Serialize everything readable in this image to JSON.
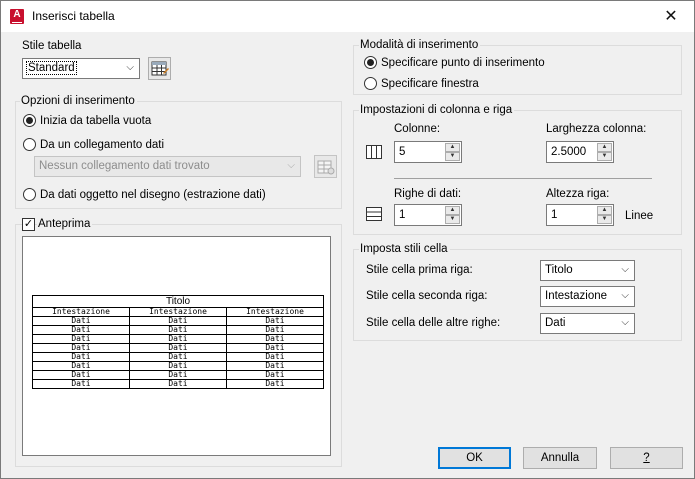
{
  "window": {
    "title": "Inserisci tabella",
    "close_glyph": "✕",
    "app_icon_letter": "A"
  },
  "table_style": {
    "label": "Stile tabella",
    "value": "Standard"
  },
  "insert_options": {
    "label": "Opzioni di inserimento",
    "empty_table": "Inizia da tabella vuota",
    "data_link": "Da un collegamento dati",
    "data_link_combo": "Nessun collegamento dati trovato",
    "data_extraction": "Da dati oggetto nel disegno (estrazione dati)",
    "selected": "empty_table"
  },
  "preview": {
    "label": "Anteprima",
    "checked": true,
    "table_title": "Titolo",
    "header_cells": [
      "Intestazione",
      "Intestazione",
      "Intestazione"
    ],
    "data_cell": "Dati",
    "data_row_count": 8
  },
  "insert_mode": {
    "label": "Modalità di inserimento",
    "point": "Specificare punto di inserimento",
    "window": "Specificare finestra",
    "selected": "point"
  },
  "col_row": {
    "label": "Impostazioni di colonna e riga",
    "columns_label": "Colonne:",
    "columns_value": "5",
    "col_width_label": "Larghezza colonna:",
    "col_width_value": "2.5000",
    "data_rows_label": "Righe di dati:",
    "data_rows_value": "1",
    "row_height_label": "Altezza riga:",
    "row_height_value": "1",
    "row_height_unit": "Linee"
  },
  "cell_styles": {
    "label": "Imposta stili cella",
    "first_row_label": "Stile cella prima riga:",
    "first_row_value": "Titolo",
    "second_row_label": "Stile cella seconda riga:",
    "second_row_value": "Intestazione",
    "other_rows_label": "Stile cella delle altre righe:",
    "other_rows_value": "Dati"
  },
  "buttons": {
    "ok": "OK",
    "cancel": "Annulla",
    "help": "?"
  }
}
